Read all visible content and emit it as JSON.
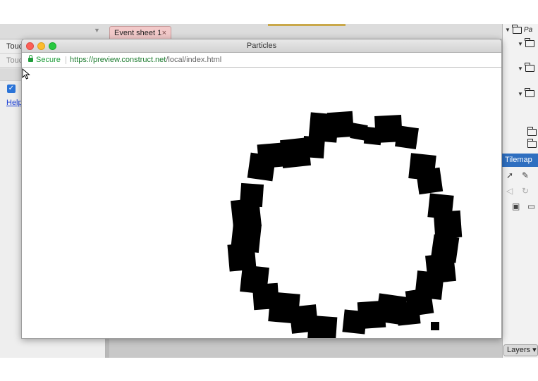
{
  "editor": {
    "left_panel": {
      "row1_label": "Touc",
      "row2_label": "Touc",
      "checkbox_checked": true,
      "help_link": "Help"
    },
    "tab": {
      "label": "Event sheet 1",
      "close_glyph": "×"
    },
    "right_panel": {
      "top_label": "Pa",
      "tilemap_header": "Tilemap",
      "layers_button": "Layers ▾"
    }
  },
  "preview_window": {
    "title": "Particles",
    "security_label": "Secure",
    "url_host": "https://preview.construct.net",
    "url_path": "/local/index.html",
    "content": "black particle ring on white canvas"
  },
  "icons": [
    "lock-icon",
    "folder-icon",
    "pointer-tool-icon",
    "pencil-tool-icon",
    "eraser-tool-icon",
    "rotate-tool-icon",
    "save-icon",
    "open-folder-icon",
    "mouse-cursor-icon"
  ],
  "colors": {
    "title_red": "#fc5f57",
    "title_yellow": "#fdbc2e",
    "title_green": "#28c840",
    "secure_green": "#1f9d3a",
    "tilemap_blue": "#2f6fc0",
    "tab_pink": "#f2c9c9",
    "particles": "#000000"
  }
}
